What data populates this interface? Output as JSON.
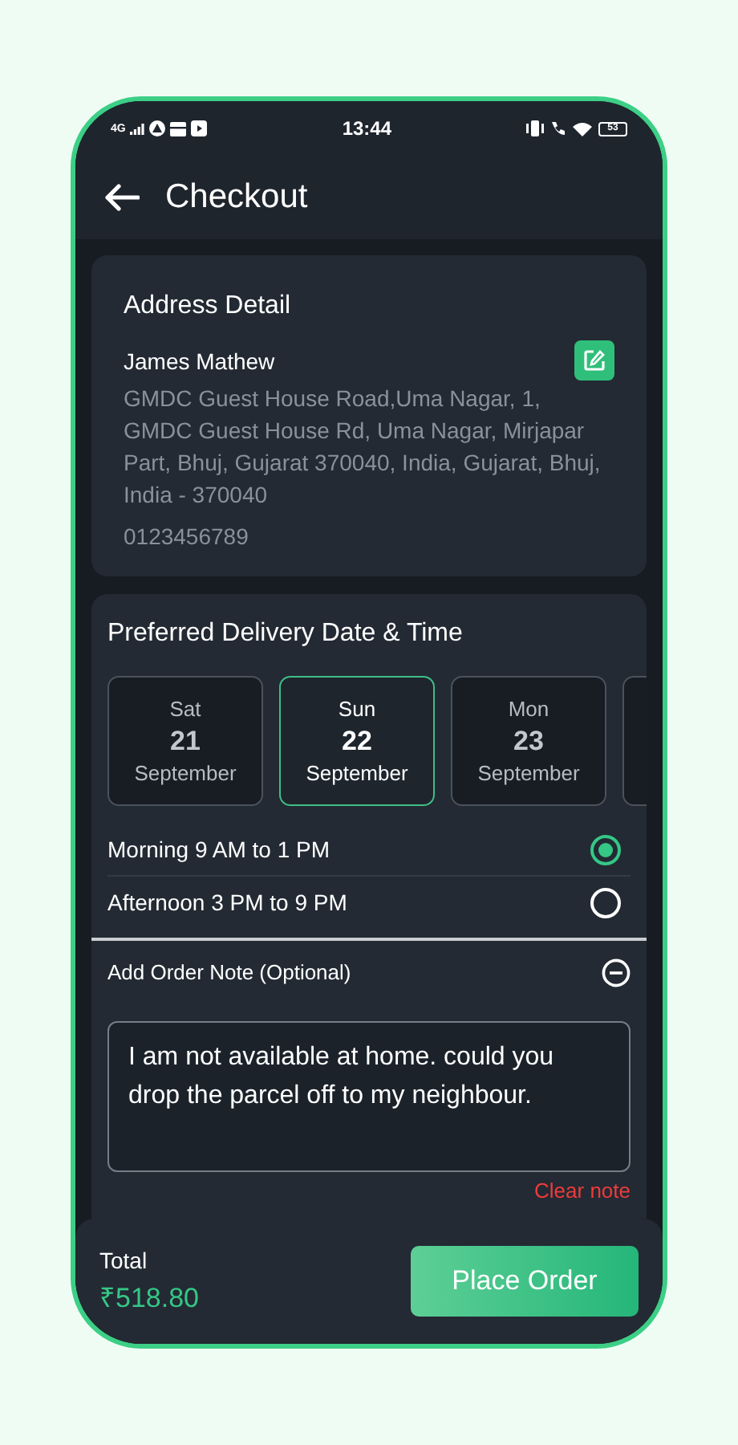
{
  "status_bar": {
    "network": "4G",
    "time": "13:44",
    "battery": "53"
  },
  "header": {
    "title": "Checkout"
  },
  "address": {
    "title": "Address Detail",
    "name": "James Mathew",
    "lines": "GMDC Guest House Road,Uma Nagar, 1, GMDC Guest House Rd, Uma Nagar, Mirjapar Part, Bhuj, Gujarat 370040, India, Gujarat, Bhuj, India - 370040",
    "phone": "0123456789"
  },
  "delivery": {
    "title": "Preferred Delivery Date & Time",
    "dates": [
      {
        "day": "Sat",
        "date": "21",
        "month": "September",
        "selected": false
      },
      {
        "day": "Sun",
        "date": "22",
        "month": "September",
        "selected": true
      },
      {
        "day": "Mon",
        "date": "23",
        "month": "September",
        "selected": false
      }
    ],
    "slots": [
      {
        "label": "Morning 9 AM to 1 PM",
        "selected": true
      },
      {
        "label": "Afternoon 3 PM to 9 PM",
        "selected": false
      }
    ]
  },
  "note": {
    "title": "Add Order Note (Optional)",
    "expanded": true,
    "value": "I am not available at home. could you drop the parcel off to my neighbour.",
    "clear": "Clear note"
  },
  "footer": {
    "total_label": "Total",
    "total": "₹518.80",
    "button": "Place Order"
  }
}
